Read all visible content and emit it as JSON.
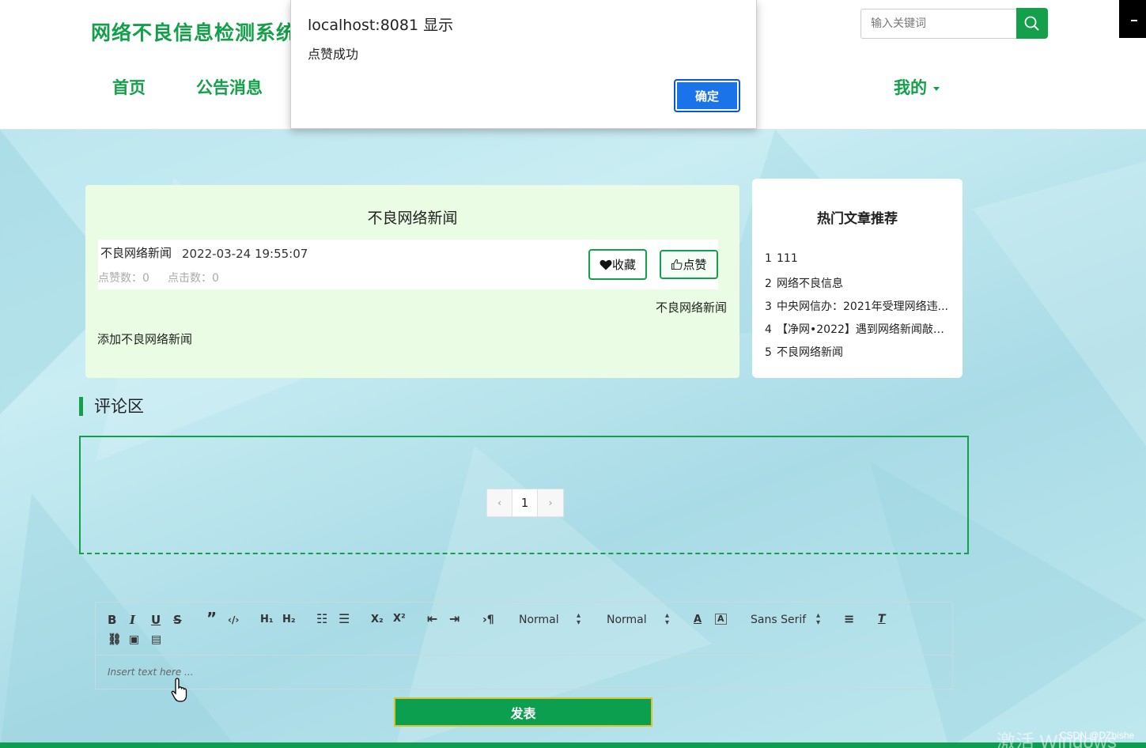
{
  "header": {
    "logo": "网络不良信息检测系统",
    "nav": {
      "home": "首页",
      "notice": "公告消息",
      "mine": "我的"
    },
    "search": {
      "placeholder": "输入关键词"
    }
  },
  "alert": {
    "title": "localhost:8081 显示",
    "message": "点赞成功",
    "ok_label": "确定"
  },
  "article": {
    "title": "不良网络新闻",
    "category": "不良网络新闻",
    "date": "2022-03-24 19:55:07",
    "likes": "点赞数：0",
    "clicks": "点击数：0",
    "collect_label": "收藏",
    "like_label": "点赞",
    "right_text": "不良网络新闻",
    "content": "添加不良网络新闻"
  },
  "hot": {
    "title": "热门文章推荐",
    "items": [
      {
        "num": "1",
        "text": "111"
      },
      {
        "num": "2",
        "text": "网络不良信息"
      },
      {
        "num": "3",
        "text": "中央网信办：2021年受理网络违..."
      },
      {
        "num": "4",
        "text": "【净网•2022】遇到网络新闻敲诈..."
      },
      {
        "num": "5",
        "text": "不良网络新闻"
      }
    ]
  },
  "comments": {
    "heading": "评论区",
    "pager": {
      "prev": "‹",
      "page": "1",
      "next": "›"
    }
  },
  "editor": {
    "header_select": "Normal",
    "size_select": "Normal",
    "font_select": "Sans Serif",
    "placeholder": "Insert text here ...",
    "submit_label": "发表"
  },
  "overlay": {
    "watermark": "激活 Windows",
    "csdn": "CSDN @DZbishe"
  },
  "colors": {
    "accent": "#14a04a",
    "dialog_button": "#1a73e8",
    "card_bg": "#eafce4"
  }
}
